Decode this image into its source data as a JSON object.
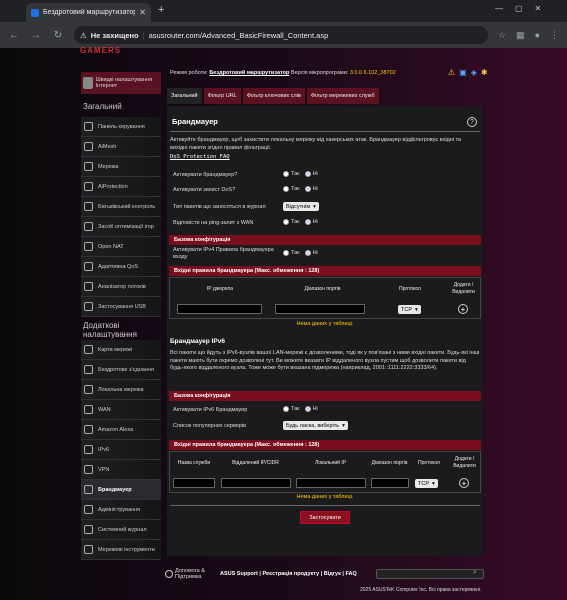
{
  "browser": {
    "tab_title": "Бездротовий маршрутизатор A",
    "warning": "Не захищено",
    "url": "asusrouter.com/Advanced_BasicFirewall_Content.asp"
  },
  "sidebar": {
    "quick": "Швидкі налаштування Інтернет",
    "general_title": "Загальний",
    "general": [
      "Панель керування",
      "AiMesh",
      "Мережа",
      "AiProtection",
      "Батьківський контроль",
      "ЗасоК оптимізації ігор",
      "Open NAT",
      "Адаптивна QoS",
      "Аналізатор потоків",
      "Застосування USB"
    ],
    "advanced_title": "Додаткові налаштування",
    "advanced": [
      "Карта мережі",
      "Бездротове з'єднання",
      "Локальна мережа",
      "WAN",
      "Amazon Alexa",
      "IPv6",
      "VPN",
      "Брандмауер",
      "Адміністрування",
      "Системний журнал",
      "Мережеві інструменти"
    ]
  },
  "top": {
    "mode_label": "Режим роботи:",
    "mode_value": "Бездротовий маршрутизатор",
    "fw_label": "Версія мікропрограми:",
    "fw_value": "3.0.0.6.102_38702"
  },
  "tabs": [
    "Загальний",
    "Фільтр URL",
    "Фільтр ключових слів",
    "Фільтр мережевих служб"
  ],
  "main": {
    "title": "Брандмауер",
    "desc": "Активуйте брандмауер, щоб захистити локальну мережу від хакерських атак. Брандмауер відфільтровує вхідні та вихідні пакети згідно правил фільтрації.",
    "faq": "DoS Protection FAQ",
    "fields": [
      {
        "label": "Активувати брандмауер?",
        "yes": "Так",
        "no": "Ні"
      },
      {
        "label": "Активувати захист DoS?",
        "yes": "Так",
        "no": "Ні"
      },
      {
        "label": "Тип пакетів що заносяться в журнал",
        "select": "Відсутнім"
      },
      {
        "label": "Відповісти на ping-запит з WAN",
        "yes": "Так",
        "no": "Ні"
      }
    ],
    "basic_config": "Базова конфігурація",
    "ipv4_enable_label": "Активувати IPv4 Правила брандмауера входу",
    "ipv4_rules_title": "Вхідні правила брандмауера (Макс. обмеження : 128)",
    "ipv4_cols": [
      "IP джерела",
      "Діапазон портів",
      "Протокол",
      "Додати / Видалити"
    ],
    "proto": "TCP",
    "nodata": "Нема даних у таблиці.",
    "ipv6_title": "Брандмауер IPv6",
    "ipv6_desc": "Всі пакети що йдуть з IPv6-вузлів вашої LAN-мережі є дозволеними, тоді як у пов'язані з ними вхідні пакети. Будь-які інші пакети мають бути окремо дозволені тут. Ви можете вказати IP віддаленого вузла пустим щоб дозволити пакети від будь-якого віддаленого вузла. Тоже може бути вказана підмережа (наприклад, 2001::1111:2222:3333/64).",
    "ipv6_basic": "Базова конфігурація",
    "ipv6_enable_label": "Активувати IPv6 Брандмауер",
    "popular_label": "Список популярних серверів",
    "popular_select": "Будь ласка, виберіть",
    "ipv6_rules_title": "Вхідні правила брандмауера (Макс. обмеження : 128)",
    "ipv6_cols": [
      "Назва служби",
      "Віддалений IP/CIDR",
      "Локальний IP",
      "Діапазон портів",
      "Протокол",
      "Додати / Видалити"
    ],
    "apply": "Застосувати",
    "yes": "Так",
    "no": "Ні"
  },
  "footer": {
    "help": "Допомога & Підтримка",
    "links": "ASUS Support | Реєстрація продукту | Відгук | FAQ",
    "copy": "2025 ASUSTeK Computer Inc. Всі права застережені."
  }
}
